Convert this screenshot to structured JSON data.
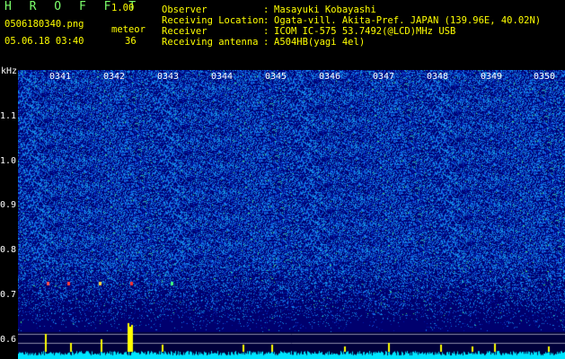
{
  "header": {
    "brand": "H R O F F T",
    "version": "1.00",
    "filename": "0506180340.png",
    "datetime": "05.06.18 03:40",
    "meteor_label": "meteor",
    "meteor_count": "36"
  },
  "info": [
    {
      "key": "Observer",
      "value": "Masayuki Kobayashi"
    },
    {
      "key": "Receiving Location",
      "value": "Ogata-vill. Akita-Pref. JAPAN (139.96E, 40.02N)"
    },
    {
      "key": "Receiver",
      "value": "ICOM IC-575 53.7492(@LCD)MHz USB"
    },
    {
      "key": "Receiving antenna",
      "value": "A504HB(yagi 4el)"
    }
  ],
  "separator": ":",
  "y_axis": {
    "unit": "kHz",
    "labels": [
      "1.1",
      "1.0",
      "0.9",
      "0.8",
      "0.7",
      "0.6"
    ]
  },
  "time_ticks": [
    "0341",
    "0342",
    "0343",
    "0344",
    "0345",
    "0346",
    "0347",
    "0348",
    "0349",
    "0350"
  ],
  "colors": {
    "background": "#000000",
    "header_yellow": "#ffff00",
    "brand_green": "#7cff6b",
    "spectrogram_base": "#00009a",
    "spectrogram_noise": "#3a7bff",
    "trace_cyan": "#00e5ff",
    "meteor_yellow": "#ffff00"
  }
}
